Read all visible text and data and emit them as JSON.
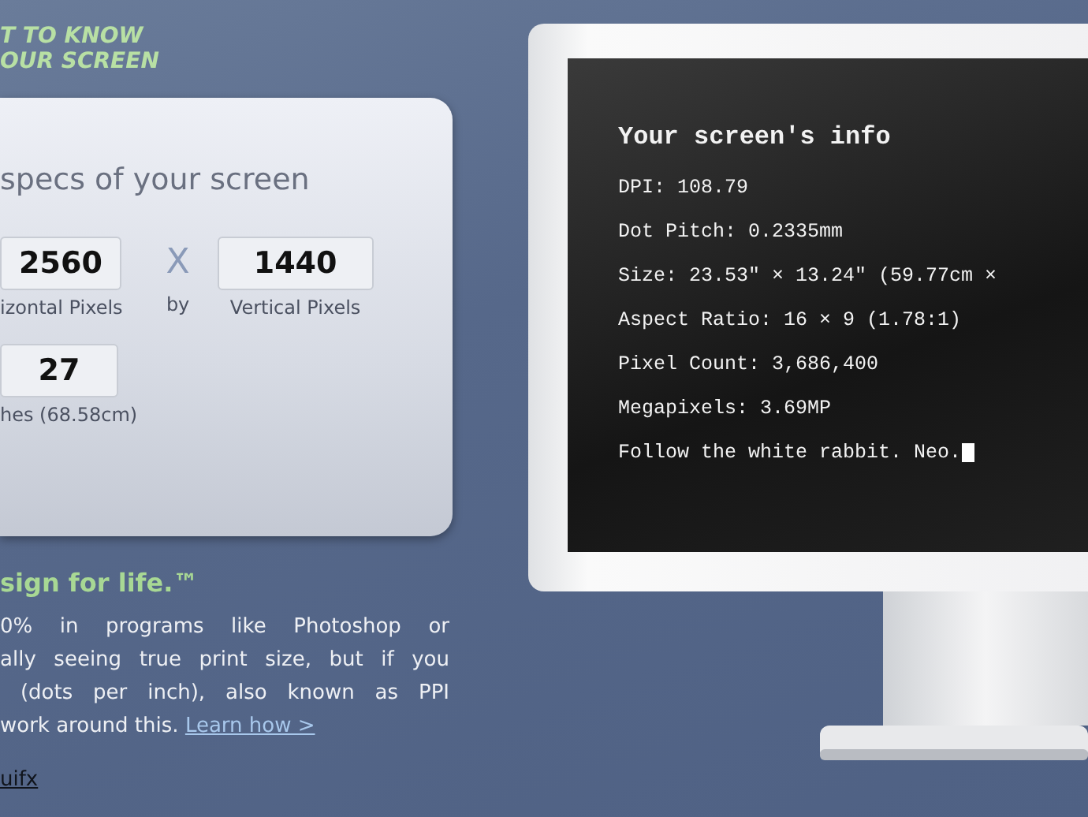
{
  "header": {
    "lines": [
      "T TO KNOW",
      "OUR SCREEN"
    ]
  },
  "specs_panel": {
    "title": "specs of your screen",
    "width": {
      "value": "2560",
      "label": "izontal Pixels"
    },
    "separator": {
      "symbol": "X",
      "label": "by"
    },
    "height": {
      "value": "1440",
      "label": "Vertical Pixels"
    },
    "diagonal": {
      "value": "27",
      "label": "hes (68.58cm)"
    }
  },
  "tagline": "sign for life.™",
  "description": {
    "lines": [
      "0% in programs like Photoshop or",
      "ally seeing true print size, but if you",
      " (dots per inch), also known as PPI",
      "work around this."
    ],
    "link": "Learn how >"
  },
  "credit_link": "uifx",
  "screen_info": {
    "title": "Your screen′s info",
    "lines": [
      "DPI: 108.79",
      "Dot Pitch: 0.2335mm",
      "Size: 23.53\" × 13.24\" (59.77cm ×",
      "Aspect Ratio: 16 × 9 (1.78:1)",
      "Pixel Count: 3,686,400",
      "Megapixels: 3.69MP",
      "Follow the white rabbit. Neo."
    ],
    "cursor": true
  }
}
